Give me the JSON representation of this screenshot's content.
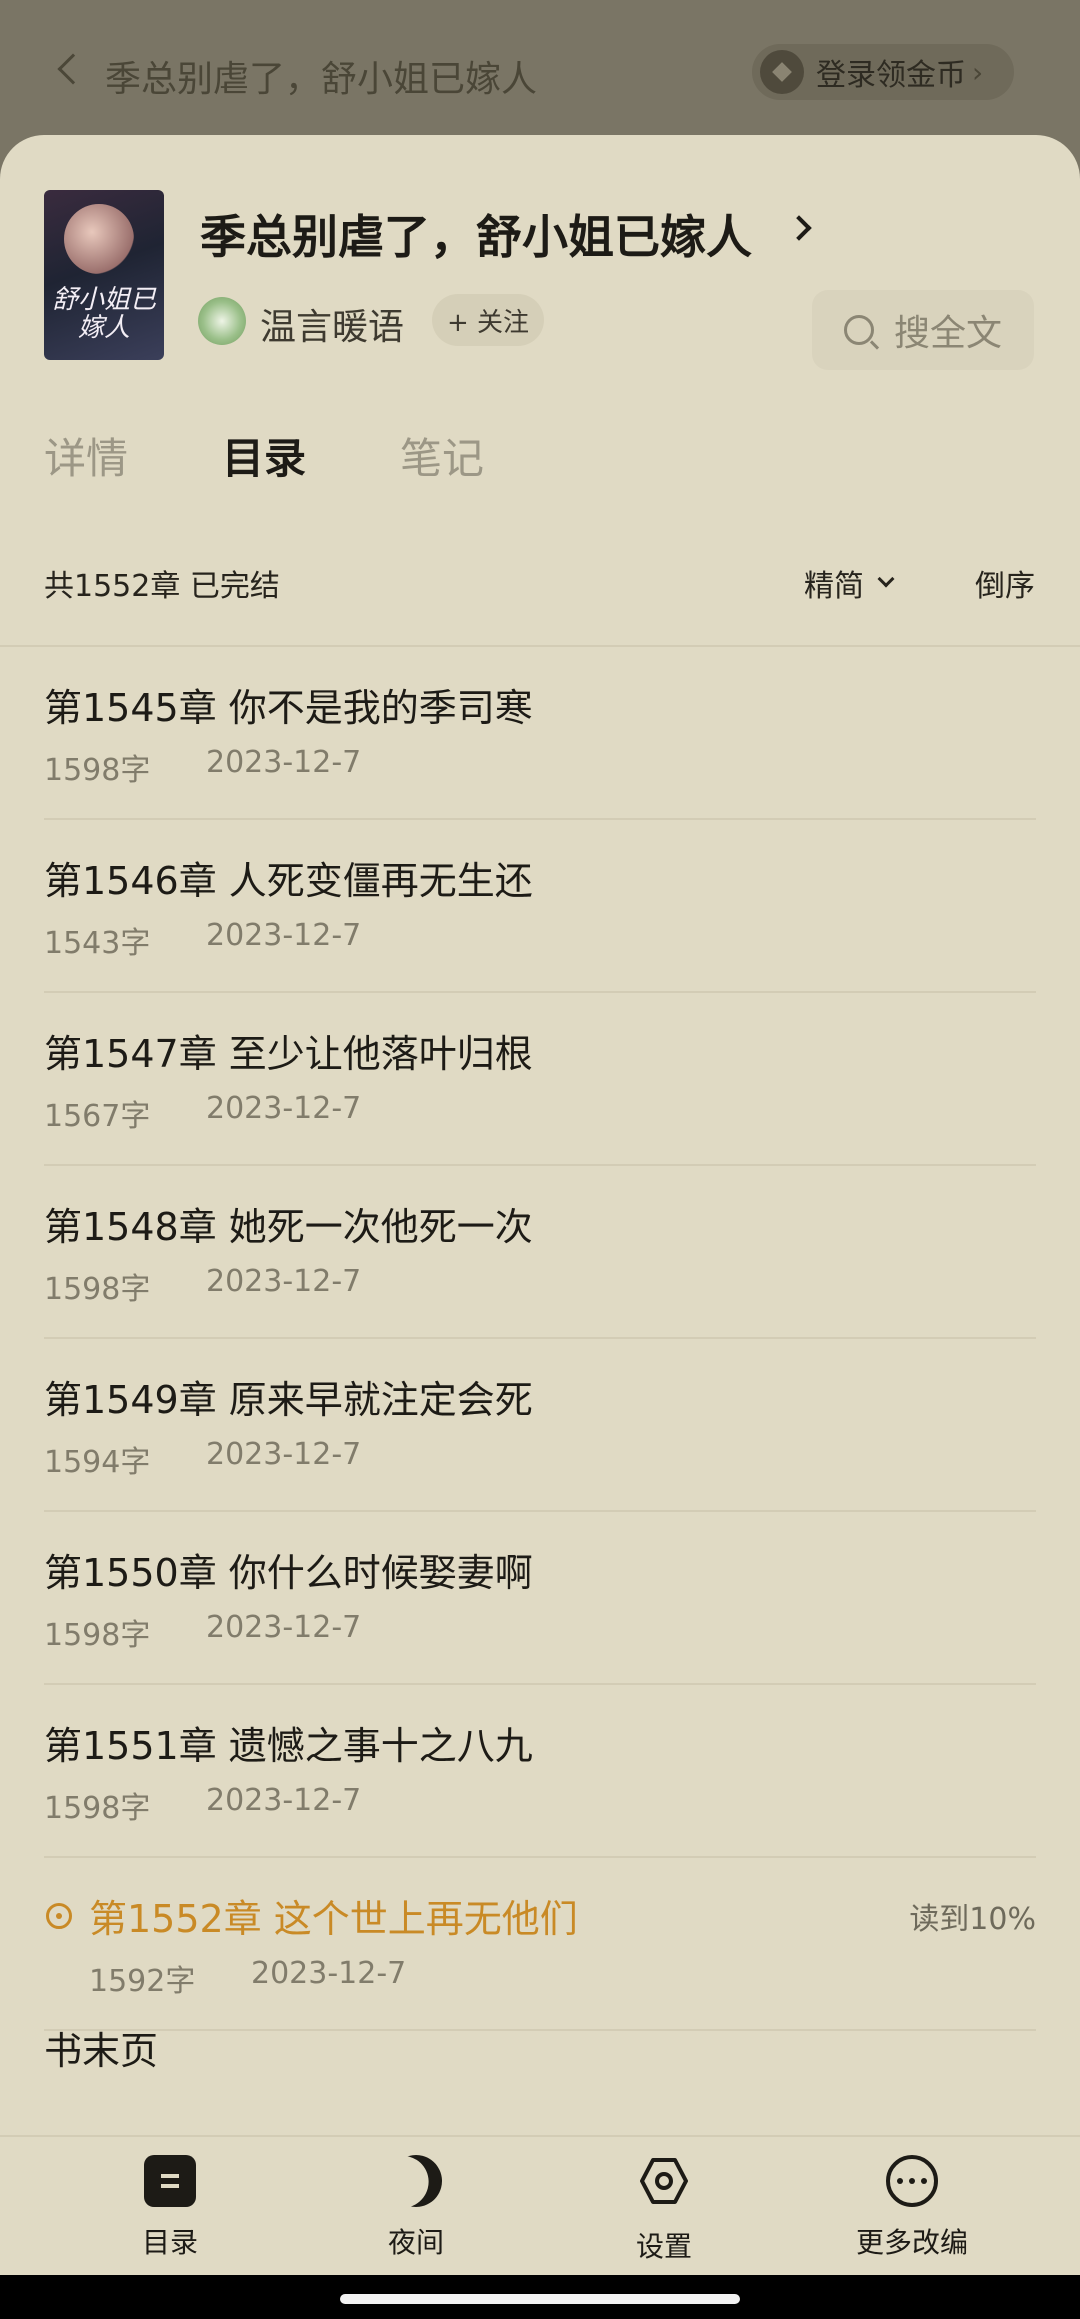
{
  "background": {
    "book_title": "季总别虐了，舒小姐已嫁人",
    "coin_button": "登录领金币"
  },
  "book": {
    "title": "季总别虐了，舒小姐已嫁人",
    "cover_text": "舒小姐已嫁人",
    "author": "温言暖语",
    "follow_label": "+ 关注",
    "search_label": "搜全文"
  },
  "tabs": [
    {
      "label": "详情",
      "active": false
    },
    {
      "label": "目录",
      "active": true
    },
    {
      "label": "笔记",
      "active": false
    }
  ],
  "toc": {
    "summary": "共1552章 已完结",
    "edition": "精简",
    "sort": "倒序",
    "chapters": [
      {
        "title": "第1545章 你不是我的季司寒",
        "words": "1598字",
        "date": "2023-12-7"
      },
      {
        "title": "第1546章 人死变僵再无生还",
        "words": "1543字",
        "date": "2023-12-7"
      },
      {
        "title": "第1547章 至少让他落叶归根",
        "words": "1567字",
        "date": "2023-12-7"
      },
      {
        "title": "第1548章 她死一次他死一次",
        "words": "1598字",
        "date": "2023-12-7"
      },
      {
        "title": "第1549章 原来早就注定会死",
        "words": "1594字",
        "date": "2023-12-7"
      },
      {
        "title": "第1550章 你什么时候娶妻啊",
        "words": "1598字",
        "date": "2023-12-7"
      },
      {
        "title": "第1551章 遗憾之事十之八九",
        "words": "1598字",
        "date": "2023-12-7"
      },
      {
        "title": "第1552章 这个世上再无他们",
        "words": "1592字",
        "date": "2023-12-7",
        "current": true,
        "progress": "读到10%"
      }
    ],
    "book_end": "书末页"
  },
  "bottom_nav": [
    {
      "label": "目录",
      "icon": "toc-icon"
    },
    {
      "label": "夜间",
      "icon": "moon-icon"
    },
    {
      "label": "设置",
      "icon": "settings-icon"
    },
    {
      "label": "更多改编",
      "icon": "more-icon"
    }
  ],
  "colors": {
    "sheet_bg": "#e0dac4",
    "accent": "#c98a26",
    "text": "#1d1b16",
    "muted": "#817c6b"
  }
}
